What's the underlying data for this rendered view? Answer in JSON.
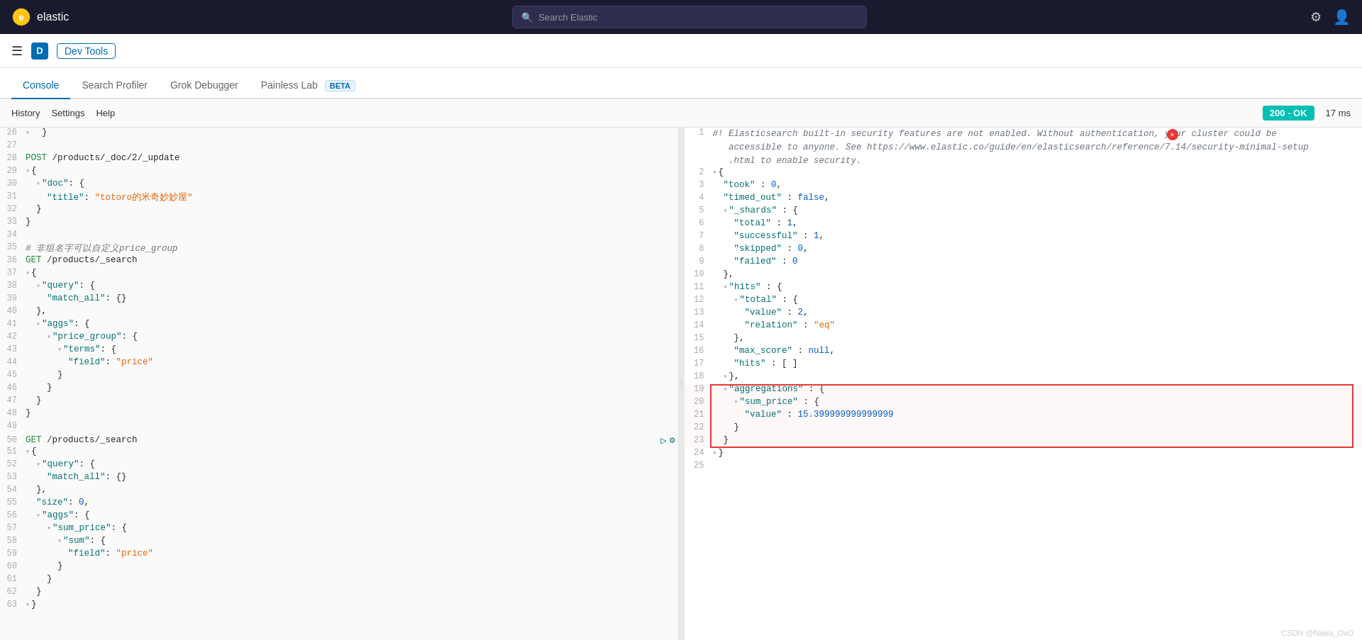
{
  "topNav": {
    "logoText": "elastic",
    "searchPlaceholder": "Search Elastic",
    "icons": [
      "help-icon",
      "user-icon"
    ]
  },
  "secondBar": {
    "appBadge": "D",
    "appTitle": "Dev Tools"
  },
  "tabs": [
    {
      "label": "Console",
      "active": true
    },
    {
      "label": "Search Profiler",
      "active": false
    },
    {
      "label": "Grok Debugger",
      "active": false
    },
    {
      "label": "Painless Lab",
      "active": false,
      "badge": "BETA"
    }
  ],
  "toolbar": {
    "items": [
      "History",
      "Settings",
      "Help"
    ],
    "statusBadge": "200 - OK",
    "responseTime": "17 ms"
  },
  "editor": {
    "lines": [
      {
        "num": "26",
        "content": "  }"
      },
      {
        "num": "27",
        "content": ""
      },
      {
        "num": "28",
        "content": "POST /products/_doc/2/_update",
        "type": "method"
      },
      {
        "num": "29",
        "content": "{"
      },
      {
        "num": "30",
        "content": "  \"doc\": {"
      },
      {
        "num": "31",
        "content": "    \"title\": \"totoro的米奇妙妙屋\""
      },
      {
        "num": "32",
        "content": "  }"
      },
      {
        "num": "33",
        "content": "}"
      },
      {
        "num": "34",
        "content": ""
      },
      {
        "num": "35",
        "content": "# 非组名字可以自定义price_group",
        "type": "comment"
      },
      {
        "num": "36",
        "content": "GET /products/_search",
        "type": "method"
      },
      {
        "num": "37",
        "content": "{"
      },
      {
        "num": "38",
        "content": "  \"query\": {"
      },
      {
        "num": "39",
        "content": "    \"match_all\": {}"
      },
      {
        "num": "40",
        "content": "  },"
      },
      {
        "num": "41",
        "content": "  \"aggs\": {"
      },
      {
        "num": "42",
        "content": "    \"price_group\": {"
      },
      {
        "num": "43",
        "content": "      \"terms\": {"
      },
      {
        "num": "44",
        "content": "        \"field\": \"price\""
      },
      {
        "num": "45",
        "content": "      }"
      },
      {
        "num": "46",
        "content": "    }"
      },
      {
        "num": "47",
        "content": "  }"
      },
      {
        "num": "48",
        "content": "}"
      },
      {
        "num": "49",
        "content": ""
      },
      {
        "num": "50",
        "content": "GET /products/_search",
        "type": "method",
        "hasActions": true
      },
      {
        "num": "51",
        "content": "{"
      },
      {
        "num": "52",
        "content": "  \"query\": {"
      },
      {
        "num": "53",
        "content": "    \"match_all\": {}"
      },
      {
        "num": "54",
        "content": "  },"
      },
      {
        "num": "55",
        "content": "  \"size\": 0,"
      },
      {
        "num": "56",
        "content": "  \"aggs\": {"
      },
      {
        "num": "57",
        "content": "    \"sum_price\": {"
      },
      {
        "num": "58",
        "content": "      \"sum\": {"
      },
      {
        "num": "59",
        "content": "        \"field\": \"price\""
      },
      {
        "num": "60",
        "content": "      }"
      },
      {
        "num": "61",
        "content": "    }"
      },
      {
        "num": "62",
        "content": "  }"
      },
      {
        "num": "63",
        "content": "}"
      }
    ]
  },
  "output": {
    "warning": "#! Elasticsearch built-in security features are not enabled. Without authentication, your cluster could be accessible to anyone. See https://www.elastic.co/guide/en/elasticsearch/reference/7.14/security-minimal-setup .html to enable security.",
    "lines": [
      {
        "num": "1",
        "isWarning": true,
        "content": "#! Elasticsearch built-in security features are not enabled. Without authentication, your cluster could be"
      },
      {
        "num": "",
        "isWarning": true,
        "content": "   accessible to anyone. See https://www.elastic.co/guide/en/elasticsearch/reference/7.14/security-minimal-setup"
      },
      {
        "num": "",
        "isWarning": true,
        "content": "   .html to enable security."
      },
      {
        "num": "2",
        "content": "{"
      },
      {
        "num": "3",
        "content": "  \"took\" : 0,"
      },
      {
        "num": "4",
        "content": "  \"timed_out\" : false,"
      },
      {
        "num": "5",
        "content": "  \"_shards\" : {"
      },
      {
        "num": "6",
        "content": "    \"total\" : 1,"
      },
      {
        "num": "7",
        "content": "    \"successful\" : 1,"
      },
      {
        "num": "8",
        "content": "    \"skipped\" : 0,"
      },
      {
        "num": "9",
        "content": "    \"failed\" : 0"
      },
      {
        "num": "10",
        "content": "  },"
      },
      {
        "num": "11",
        "content": "  \"hits\" : {"
      },
      {
        "num": "12",
        "content": "    \"total\" : {"
      },
      {
        "num": "13",
        "content": "      \"value\" : 2,"
      },
      {
        "num": "14",
        "content": "      \"relation\" : \"eq\""
      },
      {
        "num": "15",
        "content": "    },"
      },
      {
        "num": "16",
        "content": "    \"max_score\" : null,"
      },
      {
        "num": "17",
        "content": "    \"hits\" : [ ]"
      },
      {
        "num": "18",
        "content": "  },"
      },
      {
        "num": "19",
        "content": "  \"aggregations\" : {",
        "highlighted": true
      },
      {
        "num": "20",
        "content": "    \"sum_price\" : {",
        "highlighted": true
      },
      {
        "num": "21",
        "content": "      \"value\" : 15.399999999999999",
        "highlighted": true
      },
      {
        "num": "22",
        "content": "    }",
        "highlighted": true
      },
      {
        "num": "23",
        "content": "  }",
        "highlighted": true
      },
      {
        "num": "24",
        "content": "}"
      },
      {
        "num": "25",
        "content": ""
      }
    ]
  },
  "watermark": "CSDN @Naijia_OvO"
}
